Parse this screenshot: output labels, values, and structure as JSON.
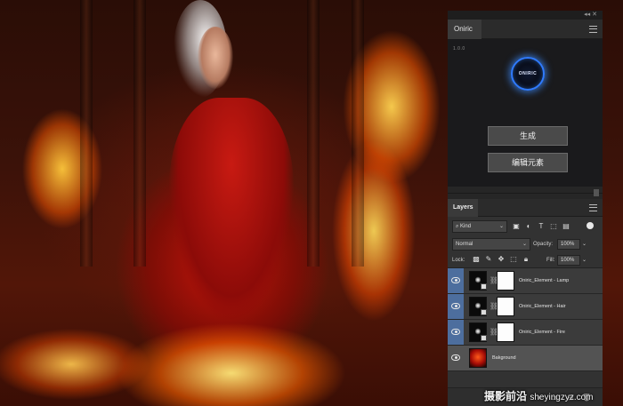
{
  "plugin_panel": {
    "tab_label": "Oniric",
    "version": "1.0.0",
    "logo_text": "ONIRIC",
    "generate_button": "生成",
    "edit_elements_button": "编辑元素",
    "accent_color": "#2f7bff"
  },
  "layers_panel": {
    "tab_label": "Layers",
    "filter_kind": "Kind",
    "blend_mode": "Normal",
    "opacity_label": "Opacity:",
    "opacity_value": "100%",
    "lock_label": "Lock:",
    "fill_label": "Fill:",
    "fill_value": "100%",
    "layers": [
      {
        "name": "Oniric_Element - Lamp",
        "visible": true,
        "selected": false
      },
      {
        "name": "Oniric_Element - Hair",
        "visible": true,
        "selected": false
      },
      {
        "name": "Oniric_Element - Fire",
        "visible": true,
        "selected": false
      },
      {
        "name": "Bakground",
        "visible": true,
        "selected": true
      }
    ],
    "selection_color": "#4d6e9e"
  },
  "watermark": {
    "cn": "摄影前沿",
    "latin": "sheyingzyz.com"
  }
}
